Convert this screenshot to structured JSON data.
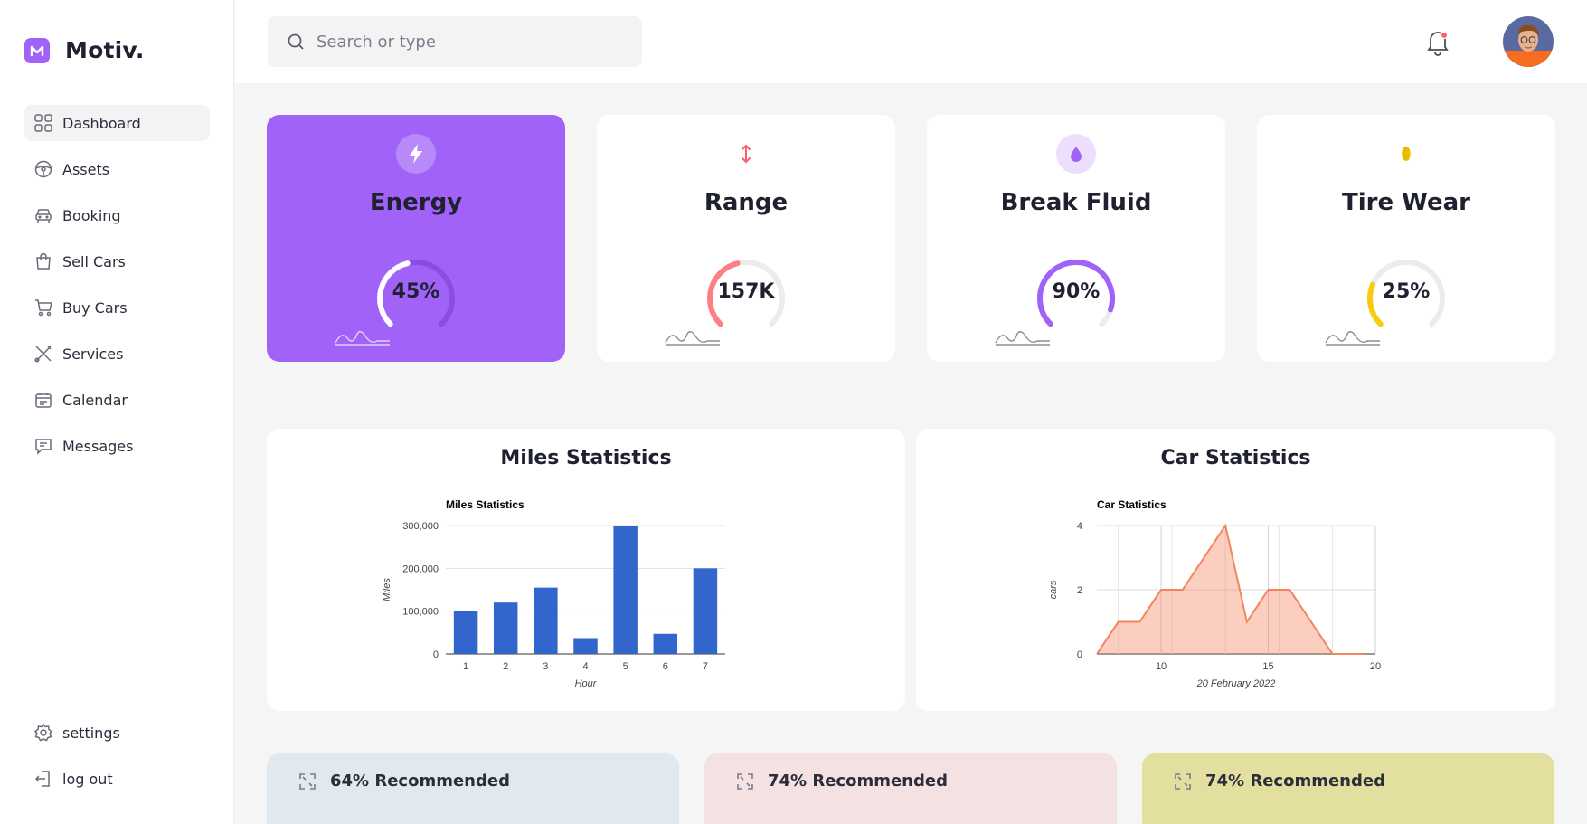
{
  "app": {
    "name": "Motiv."
  },
  "sidebar": {
    "items": [
      {
        "label": "Dashboard",
        "icon": "grid-icon",
        "active": true
      },
      {
        "label": "Assets",
        "icon": "steering-wheel-icon"
      },
      {
        "label": "Booking",
        "icon": "car-icon"
      },
      {
        "label": "Sell Cars",
        "icon": "shopping-bag-icon"
      },
      {
        "label": "Buy Cars",
        "icon": "cart-icon"
      },
      {
        "label": "Services",
        "icon": "tools-icon"
      },
      {
        "label": "Calendar",
        "icon": "calendar-icon"
      },
      {
        "label": "Messages",
        "icon": "chat-icon"
      }
    ],
    "bottom": [
      {
        "label": "settings",
        "icon": "gear-icon"
      },
      {
        "label": "log out",
        "icon": "logout-icon"
      }
    ]
  },
  "search": {
    "placeholder": "Search or type"
  },
  "stats": [
    {
      "title": "Energy",
      "value": "45%",
      "percent": 45,
      "color": "#ffffff",
      "icon": "lightning-icon"
    },
    {
      "title": "Range",
      "value": "157K",
      "percent": 45,
      "color": "#ff7e86",
      "icon": "vertical-arrows-icon"
    },
    {
      "title": "Break Fluid",
      "value": "90%",
      "percent": 90,
      "color": "#a162f7",
      "icon": "drop-icon"
    },
    {
      "title": "Tire Wear",
      "value": "25%",
      "percent": 25,
      "color": "#f6cc0d",
      "icon": "tire-icon"
    }
  ],
  "panels": {
    "miles": {
      "title": "Miles Statistics"
    },
    "car": {
      "title": "Car Statistics"
    }
  },
  "chart_data": [
    {
      "type": "bar",
      "title": "Miles Statistics",
      "xlabel": "Hour",
      "ylabel": "Miles",
      "categories": [
        "1",
        "2",
        "3",
        "4",
        "5",
        "6",
        "7"
      ],
      "values": [
        100000,
        120000,
        155000,
        37000,
        300000,
        47000,
        200000
      ],
      "yticks": [
        "0",
        "100,000",
        "200,000",
        "300,000"
      ],
      "ylim": [
        0,
        300000
      ],
      "color": "#3366cc",
      "grid": true
    },
    {
      "type": "area",
      "title": "Car Statistics",
      "xlabel": "20 February 2022",
      "ylabel": "cars",
      "x": [
        7,
        8,
        9,
        10,
        11,
        13,
        14,
        15,
        16,
        18,
        19,
        19.5
      ],
      "values": [
        0,
        1,
        1,
        2,
        2,
        4,
        1,
        2,
        2,
        0,
        0,
        0
      ],
      "xticks": [
        "10",
        "15",
        "20"
      ],
      "yticks": [
        "0",
        "2",
        "4"
      ],
      "xlim": [
        7,
        20
      ],
      "ylim": [
        0,
        4
      ],
      "color": "#f4845f",
      "grid": true
    }
  ],
  "recommendations": [
    {
      "label": "64% Recommended",
      "bg": "#e1e9ef"
    },
    {
      "label": "74% Recommended",
      "bg": "#f4e1e2"
    },
    {
      "label": "74% Recommended",
      "bg": "#e3e09f"
    }
  ]
}
